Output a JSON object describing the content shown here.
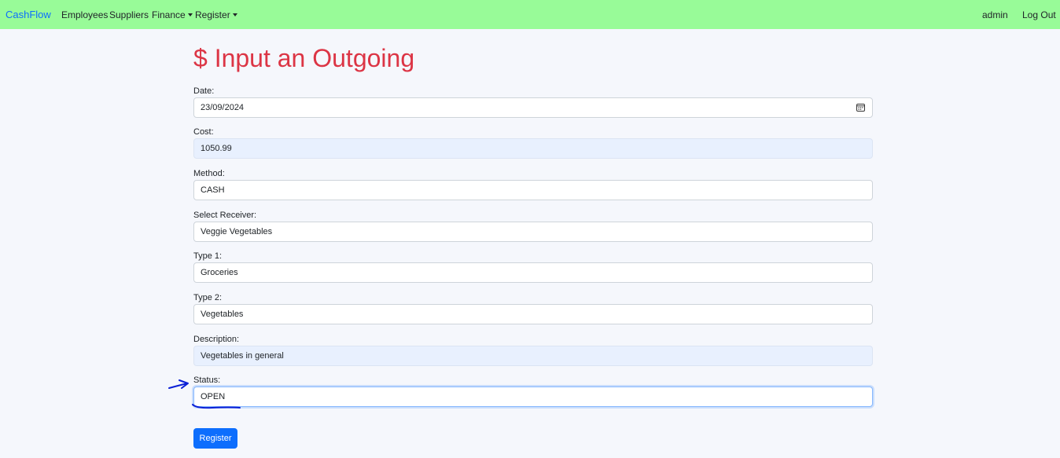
{
  "navbar": {
    "brand": "CashFlow",
    "links": {
      "employees": "Employees",
      "suppliers": "Suppliers",
      "finance": "Finance",
      "register": "Register"
    },
    "user": "admin",
    "logout": "Log Out",
    "background": "#98fb98",
    "brand_color": "#0d6efd"
  },
  "page": {
    "title": "$ Input an Outgoing",
    "title_color": "#dc3545"
  },
  "form": {
    "date": {
      "label": "Date:",
      "value": "23/09/2024",
      "icon": "calendar-icon"
    },
    "cost": {
      "label": "Cost:",
      "value": "1050.99"
    },
    "method": {
      "label": "Method:",
      "value": "CASH"
    },
    "receiver": {
      "label": "Select Receiver:",
      "value": "Veggie Vegetables"
    },
    "type1": {
      "label": "Type 1:",
      "value": "Groceries"
    },
    "type2": {
      "label": "Type 2:",
      "value": "Vegetables"
    },
    "description": {
      "label": "Description:",
      "value": "Vegetables in general"
    },
    "status": {
      "label": "Status:",
      "value": "OPEN"
    },
    "submit": "Register",
    "button_color": "#0d6efd"
  },
  "annotation": {
    "color": "#0a1fd6",
    "shapes": [
      "arrow",
      "underline"
    ]
  }
}
